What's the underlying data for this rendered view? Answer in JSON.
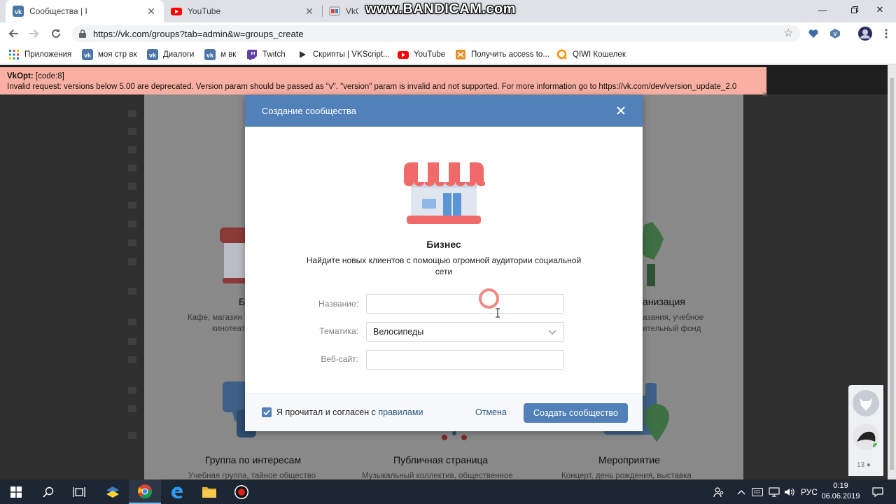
{
  "browser": {
    "tabs": [
      {
        "title": "Сообщества | Ι",
        "active": true
      },
      {
        "title": "YouTube",
        "active": false
      },
      {
        "title": "VkOpt",
        "active": false
      }
    ],
    "url": "https://vk.com/groups?tab=admin&w=groups_create",
    "watermark": "www.BANDICAM.com",
    "bookmarks": [
      {
        "label": "Приложения",
        "icon": "apps-grid-icon"
      },
      {
        "label": "моя стр вк",
        "icon": "vk-icon"
      },
      {
        "label": "Диалоги",
        "icon": "vk-icon"
      },
      {
        "label": "м вк",
        "icon": "vk-icon"
      },
      {
        "label": "Twitch",
        "icon": "twitch-icon"
      },
      {
        "label": "Скрипты | VKScript...",
        "icon": "play-icon"
      },
      {
        "label": "YouTube",
        "icon": "youtube-icon"
      },
      {
        "label": "Получить access to...",
        "icon": "app-icon"
      },
      {
        "label": "QIWI Кошелек",
        "icon": "qiwi-icon"
      }
    ]
  },
  "error_banner": {
    "title": "VkOpt:",
    "code": " [code:8]",
    "message": "Invalid request: versions below 5.00 are deprecated. Version param should be passed as \"v\". \"version\" param is invalid and not supported. For more information go to https://vk.com/dev/version_update_2.0"
  },
  "background_cards": {
    "biz_title_fragment": "Б",
    "biz_desc_1": "Кафе, магазин",
    "biz_desc_2": "кинотеат",
    "org_title_fragment": "анизация",
    "org_desc_1": "азания, учебное",
    "org_desc_2": "ительный фонд",
    "interest_title": "Группа по интересам",
    "interest_desc": "Учебная группа, тайное общество",
    "public_title": "Публичная страница",
    "public_desc": "Музыкальный коллектив, общественное",
    "event_title": "Мероприятие",
    "event_desc": "Концерт, день рождения, выставка"
  },
  "modal": {
    "title": "Создание сообщества",
    "type_title": "Бизнес",
    "type_desc": "Найдите новых клиентов с помощью огромной аудитории социальной сети",
    "name_label": "Название:",
    "name_value": "",
    "topic_label": "Тематика:",
    "topic_value": "Велосипеды",
    "website_label": "Веб-сайт:",
    "website_value": "",
    "agree_text": "Я прочитал и согласен с ",
    "agree_link": "правилами",
    "agree_checked": true,
    "cancel_label": "Отмена",
    "submit_label": "Создать сообщество"
  },
  "chat": {
    "count": "13"
  },
  "taskbar": {
    "language": "РУС",
    "time": "0:19",
    "date": "06.06.2019"
  },
  "colors": {
    "vk_blue": "#5181b8",
    "error_bg": "#f9b0a2",
    "taskbar": "#1d2633"
  }
}
